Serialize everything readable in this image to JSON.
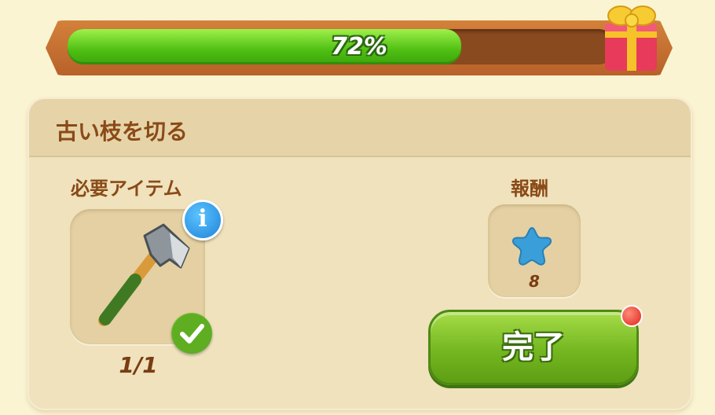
{
  "progress": {
    "percent_label": "72%",
    "value": 0.72
  },
  "task": {
    "title": "古い枝を切る",
    "required_label": "必要アイテム",
    "required_item": {
      "icon": "axe-icon",
      "count_label": "1/1",
      "complete": true
    },
    "reward_label": "報酬",
    "reward": {
      "icon": "blue-star-icon",
      "amount": "8"
    },
    "complete_button_label": "完了"
  },
  "colors": {
    "background": "#fbf4d2",
    "progress_fill": "#4fbf12",
    "button_green": "#74b720",
    "text_brown": "#8a4a18",
    "notify_red": "#e0241a"
  }
}
